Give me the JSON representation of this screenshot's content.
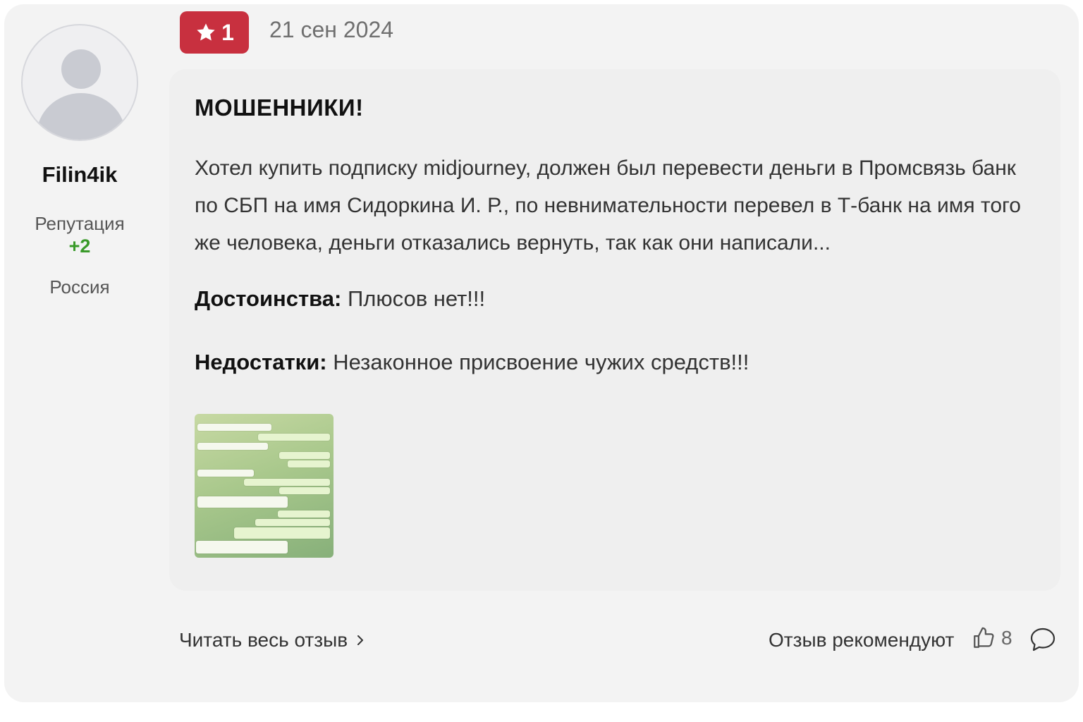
{
  "author": {
    "username": "Filin4ik",
    "reputation_label": "Репутация",
    "reputation_value": "+2",
    "country": "Россия"
  },
  "review": {
    "rating": "1",
    "date": "21 сен 2024",
    "title": "МОШЕННИКИ!",
    "text": "Хотел купить подписку midjourney, должен был перевести деньги в Промсвязь банк по СБП на имя Сидоркина И. Р., по невнимательности перевел в Т-банк на имя того же человека, деньги отказались вернуть, так как они написали...",
    "pros_label": "Достоинства:",
    "pros_text": "Плюсов нет!!!",
    "cons_label": "Недостатки:",
    "cons_text": "Незаконное присвоение чужих средств!!!"
  },
  "footer": {
    "read_more": "Читать весь отзыв",
    "recommend_label": "Отзыв рекомендуют",
    "like_count": "8"
  },
  "colors": {
    "rating_badge": "#c8303f",
    "reputation_positive": "#3a9a2a",
    "card_background": "#f3f3f3"
  },
  "icons": {
    "rating": "star-icon",
    "read_more": "chevron-right-icon",
    "like": "thumbs-up-icon",
    "comment": "speech-bubble-icon"
  }
}
